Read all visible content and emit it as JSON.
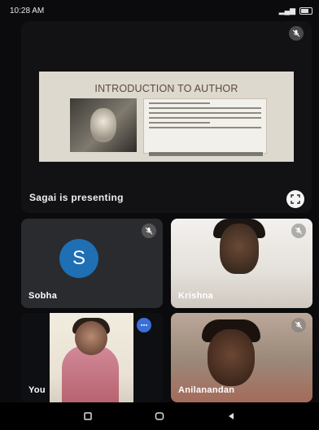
{
  "status_bar": {
    "time": "10:28 AM"
  },
  "presentation": {
    "label": "Sagai is presenting",
    "slide_title": "INTRODUCTION TO AUTHOR"
  },
  "participants": [
    {
      "name": "Sobha",
      "avatar_letter": "S",
      "avatar_color": "#1e6fb4",
      "muted": true
    },
    {
      "name": "Krishna",
      "muted": true
    },
    {
      "name": "You",
      "muted": false,
      "speaking": true
    },
    {
      "name": "Anilanandan",
      "muted": true
    }
  ],
  "nav_bar": {
    "icons": [
      "recents-icon",
      "home-icon",
      "back-icon"
    ]
  }
}
